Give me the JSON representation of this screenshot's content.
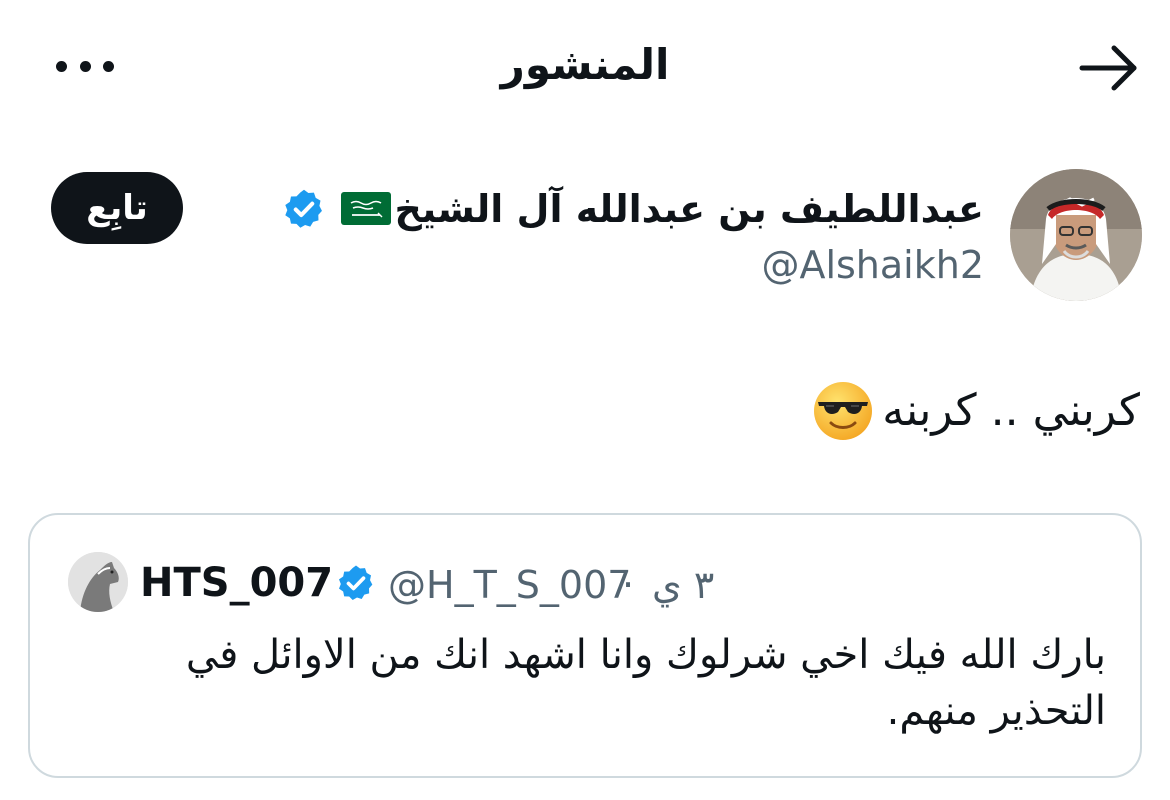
{
  "header": {
    "title": "المنشور",
    "more_icon": "more-horizontal-icon",
    "back_icon": "arrow-right-icon"
  },
  "author": {
    "name": "عبداللطيف بن عبدالله آل الشيخ",
    "handle": "@Alshaikh2",
    "flag": "saudi-flag-emoji",
    "verified": true,
    "follow_label": "تابِع"
  },
  "post": {
    "text": "كربني .. كربنه",
    "emoji": "smiling-face-with-sunglasses-emoji"
  },
  "quote": {
    "name": "HTS_007",
    "handle": "@H_T_S_007",
    "separator": "·",
    "time": "٣ ي",
    "verified": true,
    "text": "بارك الله فيك اخي شرلوك وانا اشهد انك من الاوائل في التحذير منهم."
  },
  "colors": {
    "text_primary": "#0f1419",
    "text_secondary": "#536471",
    "verified_blue": "#1d9bf0",
    "border": "#cfd9de",
    "follow_bg": "#0f1419",
    "flag_green": "#006c35"
  }
}
